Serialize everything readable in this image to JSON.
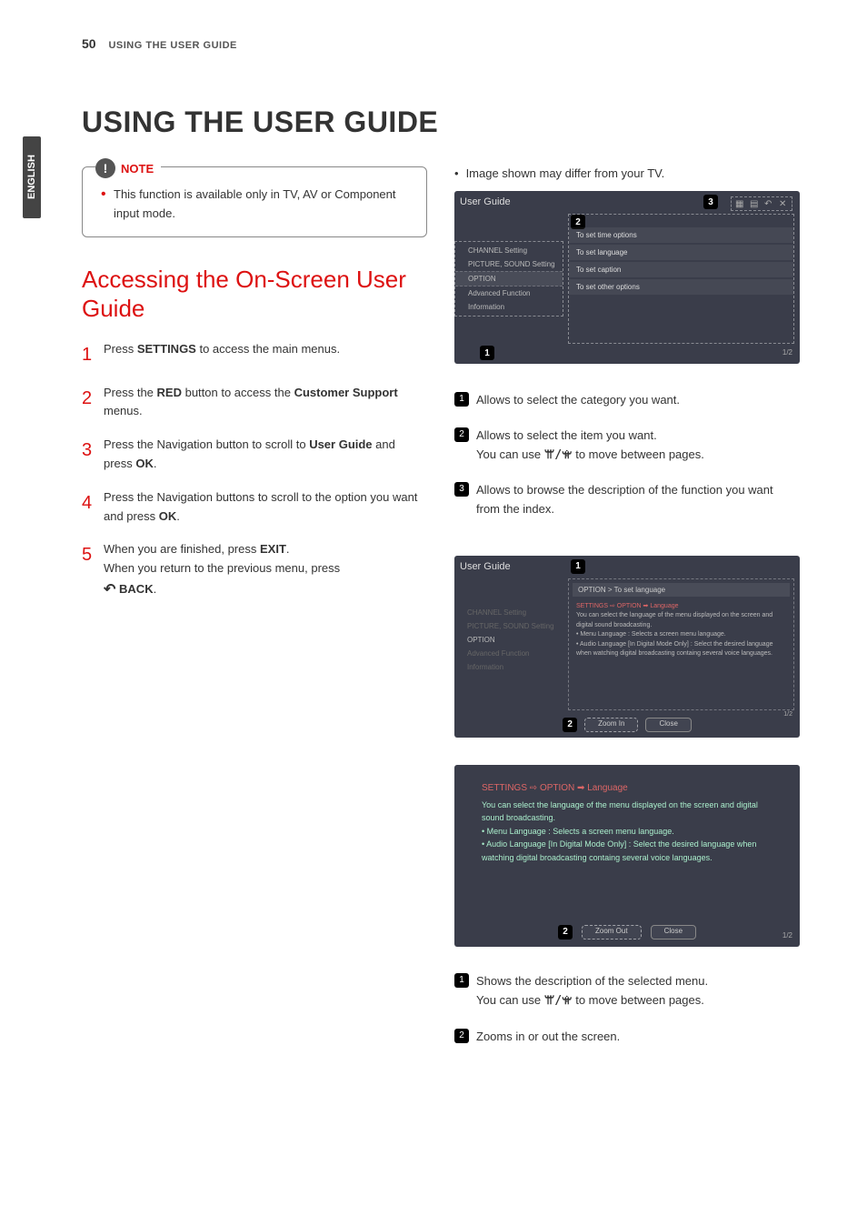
{
  "header": {
    "page_num": "50",
    "section": "USING THE USER GUIDE"
  },
  "lang_tab": "ENGLISH",
  "title": "USING THE USER GUIDE",
  "note": {
    "label": "NOTE",
    "text": "This function is available only in TV, AV or Component input mode."
  },
  "subtitle": "Accessing the On-Screen User Guide",
  "steps": {
    "s1_a": "Press ",
    "s1_b": "SETTINGS",
    "s1_c": " to access the main menus.",
    "s2_a": "Press the ",
    "s2_b": "RED",
    "s2_c": " button to access the ",
    "s2_d": "Customer Support",
    "s2_e": " menus.",
    "s3_a": "Press the Navigation button to scroll to ",
    "s3_b": "User Guide",
    "s3_c": " and press ",
    "s3_d": "OK",
    "s3_e": ".",
    "s4_a": "Press the Navigation buttons to scroll to the option you want and press ",
    "s4_b": "OK",
    "s4_c": ".",
    "s5_a": "When you are finished, press ",
    "s5_b": "EXIT",
    "s5_c": ".",
    "s5_d": "When you return to the previous menu, press ",
    "s5_back": "BACK",
    "s5_e": "."
  },
  "step_nums": {
    "n1": "1",
    "n2": "2",
    "n3": "3",
    "n4": "4",
    "n5": "5"
  },
  "right_note": "Image shown may differ from your TV.",
  "tv1": {
    "title": "User Guide",
    "side": [
      "CHANNEL Setting",
      "PICTURE, SOUND Setting",
      "OPTION",
      "Advanced Function",
      "Information"
    ],
    "rows": [
      "To set time options",
      "To set language",
      "To set caption",
      "To set other options"
    ],
    "c1": "1",
    "c2": "2",
    "c3": "3",
    "page": "1/2"
  },
  "tv1_desc": {
    "d1": "Allows to select the category you want.",
    "d2a": "Allows to select the item you want.",
    "d2b_a": "You can use ",
    "d2b_b": " to move between pages.",
    "d3a": "Allows to browse the description of the function you want from the index."
  },
  "tv2": {
    "title": "User Guide",
    "side": [
      "CHANNEL Setting",
      "PICTURE, SOUND Setting",
      "OPTION",
      "Advanced Function",
      "Information"
    ],
    "pathbar": "OPTION > To set language",
    "path": "SETTINGS ⇨ OPTION ➡ Language",
    "body1": "You can select the language of the menu displayed on the screen and digital sound broadcasting.",
    "body2": "Menu Language : Selects a screen menu language.",
    "body3": "Audio Language  [In Digital Mode Only] : Select the desired language when watching digital broadcasting containg several voice languages.",
    "zoom": "Zoom In",
    "close": "Close",
    "c1": "1",
    "c2": "2",
    "page": "1/2"
  },
  "tv3": {
    "path": "SETTINGS ⇨ OPTION ➡ Language",
    "body1": "You can select the language of the menu displayed on the screen and digital sound broadcasting.",
    "body2": "Menu Language : Selects a screen menu language.",
    "body3": "Audio Language [In Digital Mode Only] : Select the desired language when watching digital broadcasting containg several voice languages.",
    "zoom": "Zoom Out",
    "close": "Close",
    "c2": "2",
    "page": "1/2"
  },
  "tv3_desc": {
    "d1a": "Shows the description of the selected menu.",
    "d1b_a": "You can use ",
    "d1b_b": " to move between pages.",
    "d2": "Zooms in or out the screen."
  },
  "badges": {
    "b1": "1",
    "b2": "2",
    "b3": "3"
  },
  "updn": "ꕌ/ꕍ"
}
